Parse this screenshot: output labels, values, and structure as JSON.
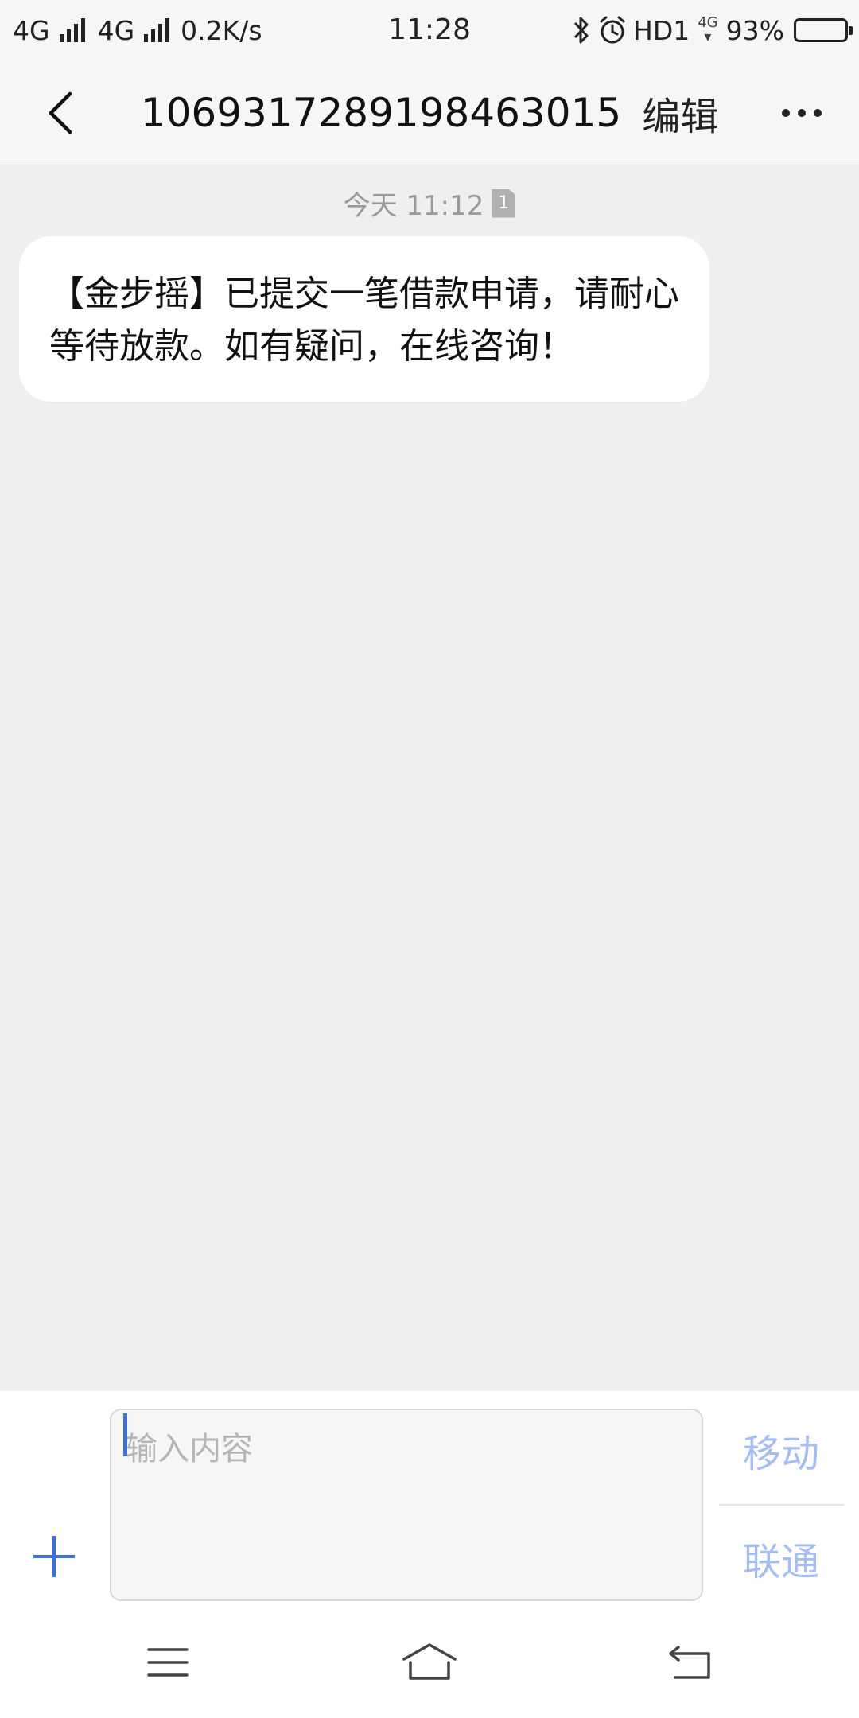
{
  "status_bar": {
    "net1": "4G",
    "net2": "4G",
    "speed": "0.2K/s",
    "time": "11:28",
    "hd": "HD1",
    "sim_net": "4G",
    "battery": "93%",
    "battery_level": 0.93
  },
  "header": {
    "title": "1069317289198463015",
    "edit_label": "编辑"
  },
  "conversation": {
    "timestamp": "今天 11:12",
    "sim_badge": "1",
    "messages": [
      {
        "text": "【金步摇】已提交一笔借款申请，请耐心等待放款。如有疑问，在线咨询！"
      }
    ]
  },
  "composer": {
    "placeholder": "输入内容",
    "send_sim1": "移动",
    "send_sim2": "联通"
  },
  "colors": {
    "accent": "#3f6fd8",
    "send_disabled": "#a5bdf0",
    "background": "#efefef"
  }
}
